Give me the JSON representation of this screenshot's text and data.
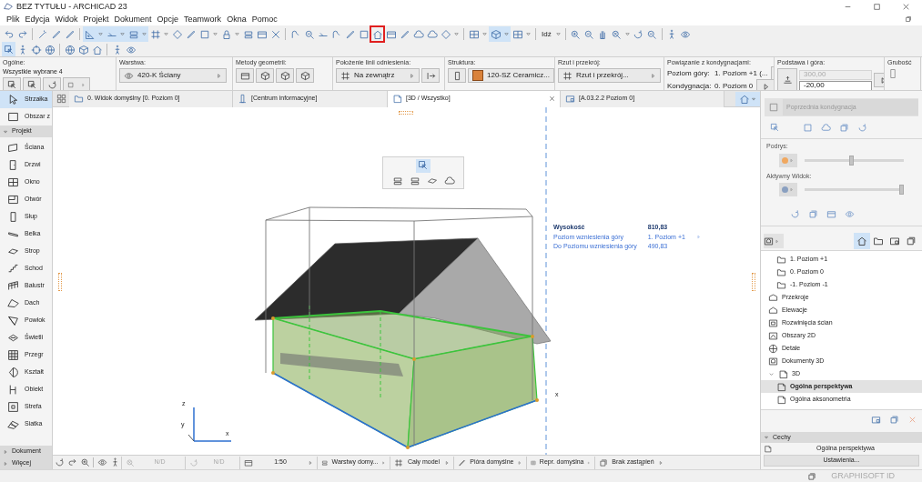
{
  "window": {
    "title": "BEZ TYTUŁU - ARCHICAD 23"
  },
  "menu": [
    "Plik",
    "Edycja",
    "Widok",
    "Projekt",
    "Dokument",
    "Opcje",
    "Teamwork",
    "Okna",
    "Pomoc"
  ],
  "toolbar": [
    {
      "kind": "undo",
      "on": false,
      "marked": false
    },
    {
      "kind": "redo",
      "on": false,
      "marked": false
    },
    {
      "kind": "sep",
      "on": false,
      "marked": false
    },
    {
      "kind": "wand",
      "on": false,
      "marked": false
    },
    {
      "kind": "pen",
      "on": false,
      "marked": false
    },
    {
      "kind": "pen",
      "on": false,
      "marked": false
    },
    {
      "kind": "sep",
      "on": false,
      "marked": false
    },
    {
      "kind": "triangle",
      "on": true,
      "marked": false
    },
    {
      "kind": "dd",
      "on": true,
      "marked": false
    },
    {
      "kind": "line",
      "on": true,
      "marked": false
    },
    {
      "kind": "dd",
      "on": true,
      "marked": false
    },
    {
      "kind": "stack",
      "on": true,
      "marked": false
    },
    {
      "kind": "dd",
      "on": true,
      "marked": false
    },
    {
      "kind": "hash",
      "on": false,
      "marked": false
    },
    {
      "kind": "dd",
      "on": false,
      "marked": false
    },
    {
      "kind": "diamond",
      "on": false,
      "marked": false
    },
    {
      "kind": "pen",
      "on": false,
      "marked": false
    },
    {
      "kind": "square",
      "on": false,
      "marked": false
    },
    {
      "kind": "dd",
      "on": false,
      "marked": false
    },
    {
      "kind": "lock",
      "on": false,
      "marked": false
    },
    {
      "kind": "dd",
      "on": false,
      "marked": false
    },
    {
      "kind": "stack",
      "on": false,
      "marked": false
    },
    {
      "kind": "frame",
      "on": false,
      "marked": false
    },
    {
      "kind": "cross",
      "on": false,
      "marked": false
    },
    {
      "kind": "sep",
      "on": false,
      "marked": false
    },
    {
      "kind": "hook",
      "on": false,
      "marked": false
    },
    {
      "kind": "zoom-out",
      "on": false,
      "marked": false
    },
    {
      "kind": "line",
      "on": false,
      "marked": false
    },
    {
      "kind": "hook",
      "on": false,
      "marked": false
    },
    {
      "kind": "pen",
      "on": false,
      "marked": false
    },
    {
      "kind": "square",
      "on": false,
      "marked": false
    },
    {
      "kind": "house",
      "on": false,
      "marked": true
    },
    {
      "kind": "frame",
      "on": false,
      "marked": false
    },
    {
      "kind": "pen",
      "on": false,
      "marked": false
    },
    {
      "kind": "cloud",
      "on": false,
      "marked": false
    },
    {
      "kind": "cloud",
      "on": false,
      "marked": false
    },
    {
      "kind": "diamond",
      "on": false,
      "marked": false
    },
    {
      "kind": "dd",
      "on": false,
      "marked": false
    },
    {
      "kind": "sep",
      "on": false,
      "marked": false
    },
    {
      "kind": "window",
      "on": false,
      "marked": false
    },
    {
      "kind": "dd",
      "on": false,
      "marked": false
    },
    {
      "kind": "cube",
      "on": true,
      "marked": false
    },
    {
      "kind": "dd",
      "on": true,
      "marked": false
    },
    {
      "kind": "window",
      "on": false,
      "marked": false
    },
    {
      "kind": "dd",
      "on": false,
      "marked": false
    },
    {
      "kind": "sep",
      "on": false,
      "marked": false
    },
    {
      "kind": "text",
      "label": "Idź",
      "on": false,
      "marked": false
    },
    {
      "kind": "dd",
      "on": false,
      "marked": false
    },
    {
      "kind": "sep",
      "on": false,
      "marked": false
    },
    {
      "kind": "zoom-in",
      "on": false,
      "marked": false
    },
    {
      "kind": "zoom-out",
      "on": false,
      "marked": false
    },
    {
      "kind": "hand",
      "on": false,
      "marked": false
    },
    {
      "kind": "zoom-fit",
      "on": false,
      "marked": false
    },
    {
      "kind": "dd",
      "on": false,
      "marked": false
    },
    {
      "kind": "orbit",
      "on": false,
      "marked": false
    },
    {
      "kind": "zoom-out",
      "on": false,
      "marked": false
    },
    {
      "kind": "sep",
      "on": false,
      "marked": false
    },
    {
      "kind": "walker",
      "on": false,
      "marked": false
    },
    {
      "kind": "eye",
      "on": false,
      "marked": false
    }
  ],
  "toolbar_2": [
    {
      "kind": "select",
      "on": true
    },
    {
      "kind": "walker",
      "on": false
    },
    {
      "kind": "target",
      "on": false
    },
    {
      "kind": "globe",
      "on": false
    },
    {
      "kind": "sep",
      "on": false
    },
    {
      "kind": "globe",
      "on": false
    },
    {
      "kind": "cube",
      "on": false
    },
    {
      "kind": "house",
      "on": false
    },
    {
      "kind": "sep",
      "on": false
    },
    {
      "kind": "walker",
      "on": false
    },
    {
      "kind": "eye",
      "on": false
    }
  ],
  "info_box": [
    {
      "kind": "general",
      "label": "Ogólne:",
      "text": "Wszystkie wybrane 4"
    },
    {
      "kind": "dropdown",
      "label": "Warstwa:",
      "value": "420-K Ściany"
    },
    {
      "kind": "geometry",
      "label": "Metody geometrii:"
    },
    {
      "kind": "reference",
      "label": "Położenie linii odniesienia:",
      "value": "Na zewnątrz"
    },
    {
      "kind": "structure",
      "label": "Struktura:",
      "value": "120-SZ Ceramicz..."
    },
    {
      "kind": "dropdown",
      "label": "Rzut i przekrój:",
      "value": "Rzut i przekrój..."
    },
    {
      "kind": "rows",
      "label": "Powiązanie z kondygnacjami:",
      "rows": [
        {
          "label": "Poziom góry:",
          "value": "1. Poziom +1 (..."
        },
        {
          "label": "Kondygnacja:",
          "value": "0. Poziom 0"
        }
      ]
    },
    {
      "kind": "fields",
      "label": "Podstawa i góra:",
      "fields": [
        {
          "value": "300,00",
          "disabled": true
        },
        {
          "value": "-20,00",
          "disabled": false
        }
      ]
    },
    {
      "kind": "plain",
      "label": "Grubość"
    }
  ],
  "toolbox": {
    "tools": [
      {
        "label": "Strzałka",
        "selected": true
      },
      {
        "label": "Obszar z",
        "selected": false
      }
    ],
    "sections": [
      {
        "label": "Projekt",
        "expanded": true,
        "tools": [
          {
            "label": "Ściana",
            "selected": false
          },
          {
            "label": "Drzwi",
            "selected": false
          },
          {
            "label": "Okno",
            "selected": false
          },
          {
            "label": "Otwór",
            "selected": false
          },
          {
            "label": "Słup",
            "selected": false
          },
          {
            "label": "Belka",
            "selected": false
          },
          {
            "label": "Strop",
            "selected": false
          },
          {
            "label": "Schod",
            "selected": false
          },
          {
            "label": "Balustr",
            "selected": false
          },
          {
            "label": "Dach",
            "selected": false
          },
          {
            "label": "Powłok",
            "selected": false
          },
          {
            "label": "Świetli",
            "selected": false
          },
          {
            "label": "Przegr",
            "selected": false
          },
          {
            "label": "Kształt",
            "selected": false
          },
          {
            "label": "Obiekt",
            "selected": false
          },
          {
            "label": "Strefa",
            "selected": false
          },
          {
            "label": "Siatka",
            "selected": false
          }
        ]
      },
      {
        "label": "Dokument",
        "expanded": false
      },
      {
        "label": "Więcej",
        "expanded": false
      }
    ]
  },
  "tabs": [
    {
      "kind": "plan",
      "label": "0. Widok domyślny [0. Poziom 0]",
      "selected": false
    },
    {
      "kind": "info",
      "label": "[Centrum informacyjne]",
      "selected": false
    },
    {
      "kind": "model",
      "label": "[3D / Wszystko]",
      "selected": true
    },
    {
      "kind": "layout",
      "label": "[A.03.2.2 Poziom 0]",
      "selected": false
    }
  ],
  "viewport": {
    "tag": {
      "title": "Wysokość",
      "title_value": "810,83",
      "rows": [
        {
          "label": "Poziom wzniesienia góry",
          "value": "1. Poziom +1"
        },
        {
          "label": "Do Poziomu wzniesienia góry",
          "value": "490,83"
        }
      ]
    },
    "axis_labels": [
      "z",
      "y",
      "x",
      "x"
    ]
  },
  "status_bar": [
    {
      "label": "N/D",
      "disabled": true
    },
    {
      "label": "N/D",
      "disabled": true
    },
    {
      "label": "1:50",
      "disabled": false
    },
    {
      "label": "Warstwy domy...",
      "disabled": false
    },
    {
      "label": "Cały model",
      "disabled": false
    },
    {
      "label": "Pióra domyślne",
      "disabled": false
    },
    {
      "label": "Repr. domyślna",
      "disabled": false
    },
    {
      "label": "Brak zastąpień",
      "disabled": false
    }
  ],
  "right_panel": {
    "previous_story": {
      "label": "Poprzednia kondygnacja",
      "disabled": true
    },
    "sliders": [
      {
        "label": "Podrys:",
        "level": 0.5
      },
      {
        "label": "Aktywny Widok:",
        "level": 1.0
      }
    ],
    "navigator_tabs": [
      {
        "selected": true
      },
      {
        "selected": false
      },
      {
        "selected": false
      },
      {
        "selected": false
      }
    ],
    "tree": [
      {
        "kind": "group",
        "children": [
          {
            "kind": "story",
            "label": "1. Poziom +1",
            "selected": false
          },
          {
            "kind": "story",
            "label": "0. Poziom 0",
            "selected": false
          },
          {
            "kind": "story",
            "label": "-1. Poziom -1",
            "selected": false
          }
        ]
      },
      {
        "kind": "section",
        "label": "Przekroje",
        "selected": false
      },
      {
        "kind": "elevation",
        "label": "Elewacje",
        "selected": false
      },
      {
        "kind": "interior",
        "label": "Rozwinięcia ścian",
        "selected": false
      },
      {
        "kind": "worksheet",
        "label": "Obszary 2D",
        "selected": false
      },
      {
        "kind": "detail",
        "label": "Detale",
        "selected": false
      },
      {
        "kind": "document",
        "label": "Dokumenty 3D",
        "selected": false
      },
      {
        "kind": "folder3d",
        "label": "3D",
        "selected": false,
        "expanded": true,
        "children": [
          {
            "kind": "view",
            "label": "Ogólna perspektywa",
            "selected": true
          },
          {
            "kind": "view",
            "label": "Ogólna aksonometria",
            "selected": false
          }
        ]
      }
    ],
    "properties": {
      "label": "Cechy",
      "expanded": true,
      "name": "Ogólna perspektywa",
      "button": "Ustawienia..."
    }
  },
  "footer": {
    "label": "GRAPHISOFT ID"
  }
}
